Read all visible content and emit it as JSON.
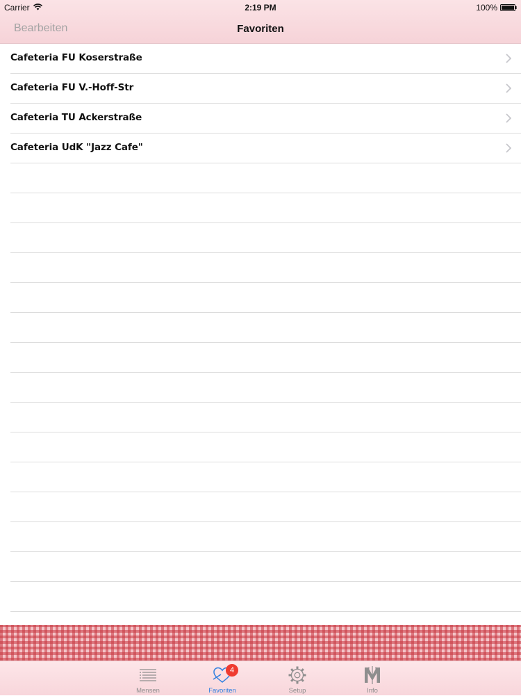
{
  "status": {
    "carrier": "Carrier",
    "time": "2:19 PM",
    "battery": "100%"
  },
  "nav": {
    "edit_label": "Bearbeiten",
    "title": "Favoriten"
  },
  "favorites": [
    {
      "label": "Cafeteria FU Koserstraße"
    },
    {
      "label": "Cafeteria FU V.-Hoff-Str"
    },
    {
      "label": "Cafeteria TU Ackerstraße"
    },
    {
      "label": "Cafeteria UdK \"Jazz Cafe\""
    }
  ],
  "tabs": [
    {
      "label": "Mensen",
      "icon": "list-icon"
    },
    {
      "label": "Favoriten",
      "icon": "heart-icon",
      "badge": "4",
      "active": true
    },
    {
      "label": "Setup",
      "icon": "gear-icon"
    },
    {
      "label": "Info",
      "icon": "m-logo-icon"
    }
  ],
  "colors": {
    "nav_background": "#f6d3d8",
    "active_tab": "#2f7fe0",
    "badge": "#ef3b30",
    "gingham_red": "#c83741"
  }
}
